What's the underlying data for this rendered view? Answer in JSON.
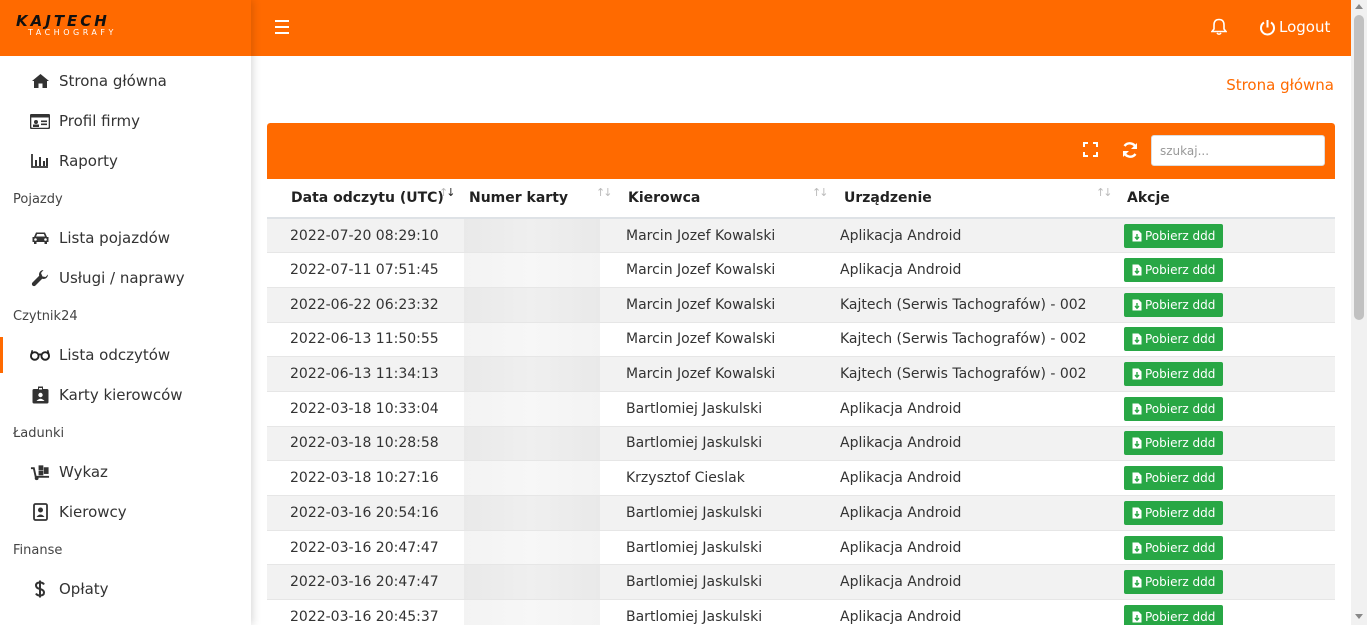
{
  "brand": {
    "name": "KAJTECH",
    "tagline": "TACHOGRAFY"
  },
  "header": {
    "logout_label": "Logout"
  },
  "breadcrumb": "Strona główna",
  "sidebar": {
    "top": [
      {
        "label": "Strona główna",
        "icon": "home-icon"
      },
      {
        "label": "Profil firmy",
        "icon": "id-card-icon"
      },
      {
        "label": "Raporty",
        "icon": "chart-icon"
      }
    ],
    "sections": [
      {
        "title": "Pojazdy",
        "items": [
          {
            "label": "Lista pojazdów",
            "icon": "car-icon"
          },
          {
            "label": "Usługi / naprawy",
            "icon": "wrench-icon"
          }
        ]
      },
      {
        "title": "Czytnik24",
        "items": [
          {
            "label": "Lista odczytów",
            "icon": "glasses-icon",
            "active": true
          },
          {
            "label": "Karty kierowców",
            "icon": "badge-icon"
          }
        ]
      },
      {
        "title": "Ładunki",
        "items": [
          {
            "label": "Wykaz",
            "icon": "dolly-icon"
          },
          {
            "label": "Kierowcy",
            "icon": "driver-icon"
          }
        ]
      },
      {
        "title": "Finanse",
        "items": [
          {
            "label": "Opłaty",
            "icon": "dollar-icon"
          }
        ]
      }
    ]
  },
  "table": {
    "search_placeholder": "szukaj...",
    "columns": [
      "Data odczytu (UTC)",
      "Numer karty",
      "Kierowca",
      "Urządzenie",
      "Akcje"
    ],
    "action_label": "Pobierz ddd",
    "rows": [
      {
        "date": "2022-07-20 08:29:10",
        "driver": "Marcin Jozef Kowalski",
        "device": "Aplikacja Android"
      },
      {
        "date": "2022-07-11 07:51:45",
        "driver": "Marcin Jozef Kowalski",
        "device": "Aplikacja Android"
      },
      {
        "date": "2022-06-22 06:23:32",
        "driver": "Marcin Jozef Kowalski",
        "device": "Kajtech (Serwis Tachografów) - 002"
      },
      {
        "date": "2022-06-13 11:50:55",
        "driver": "Marcin Jozef Kowalski",
        "device": "Kajtech (Serwis Tachografów) - 002"
      },
      {
        "date": "2022-06-13 11:34:13",
        "driver": "Marcin Jozef Kowalski",
        "device": "Kajtech (Serwis Tachografów) - 002"
      },
      {
        "date": "2022-03-18 10:33:04",
        "driver": "Bartlomiej Jaskulski",
        "device": "Aplikacja Android"
      },
      {
        "date": "2022-03-18 10:28:58",
        "driver": "Bartlomiej Jaskulski",
        "device": "Aplikacja Android"
      },
      {
        "date": "2022-03-18 10:27:16",
        "driver": "Krzysztof Cieslak",
        "device": "Aplikacja Android"
      },
      {
        "date": "2022-03-16 20:54:16",
        "driver": "Bartlomiej Jaskulski",
        "device": "Aplikacja Android"
      },
      {
        "date": "2022-03-16 20:47:47",
        "driver": "Bartlomiej Jaskulski",
        "device": "Aplikacja Android"
      },
      {
        "date": "2022-03-16 20:47:47",
        "driver": "Bartlomiej Jaskulski",
        "device": "Aplikacja Android"
      },
      {
        "date": "2022-03-16 20:45:37",
        "driver": "Bartlomiej Jaskulski",
        "device": "Aplikacja Android"
      }
    ]
  },
  "colors": {
    "accent": "#ff6a00",
    "button": "#28a745",
    "stripe": "#f2f2f2"
  }
}
